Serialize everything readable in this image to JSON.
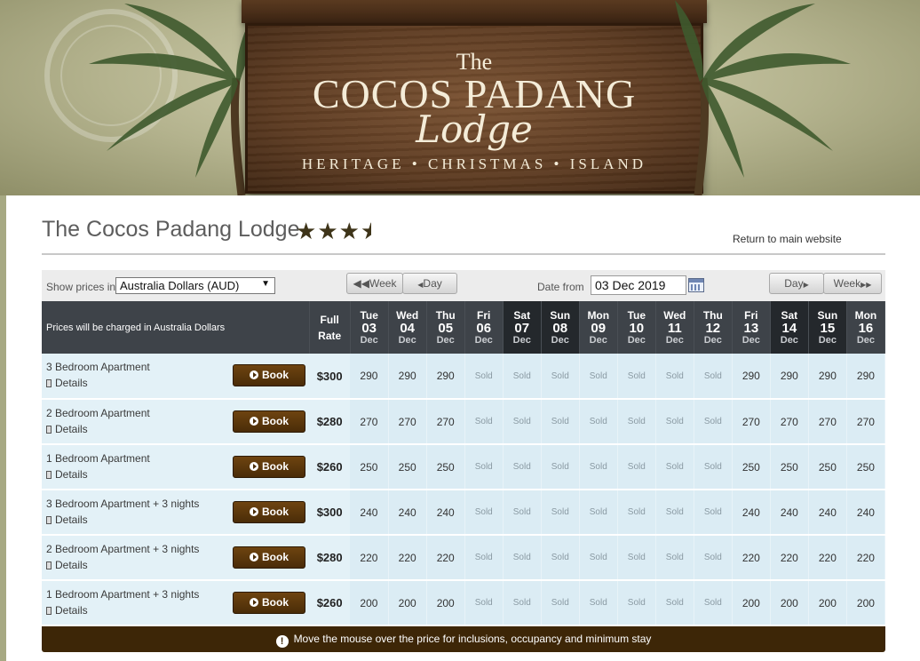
{
  "banner": {
    "logo_the": "The",
    "logo_name": "COCOS PADANG",
    "logo_lodge": "Lodge",
    "logo_tagline": "HERITAGE • CHRISTMAS • ISLAND"
  },
  "page": {
    "title": "The Cocos Padang Lodge",
    "star_rating": 3.5,
    "return_link": "Return to main website"
  },
  "controls": {
    "show_prices_label": "Show prices in",
    "currency_value": "Australia Dollars (AUD)",
    "prev_week_label": "Week",
    "prev_day_label": "Day",
    "date_from_label": "Date from",
    "date_from_value": "03 Dec 2019",
    "next_day_label": "Day",
    "next_week_label": "Week"
  },
  "table": {
    "charged_note": "Prices will be charged in Australia Dollars",
    "full_rate_label_1": "Full",
    "full_rate_label_2": "Rate",
    "book_label": "Book",
    "details_label": "Details",
    "dates": [
      {
        "day": "Tue",
        "date": "03",
        "month": "Dec"
      },
      {
        "day": "Wed",
        "date": "04",
        "month": "Dec"
      },
      {
        "day": "Thu",
        "date": "05",
        "month": "Dec"
      },
      {
        "day": "Fri",
        "date": "06",
        "month": "Dec"
      },
      {
        "day": "Sat",
        "date": "07",
        "month": "Dec"
      },
      {
        "day": "Sun",
        "date": "08",
        "month": "Dec"
      },
      {
        "day": "Mon",
        "date": "09",
        "month": "Dec"
      },
      {
        "day": "Tue",
        "date": "10",
        "month": "Dec"
      },
      {
        "day": "Wed",
        "date": "11",
        "month": "Dec"
      },
      {
        "day": "Thu",
        "date": "12",
        "month": "Dec"
      },
      {
        "day": "Fri",
        "date": "13",
        "month": "Dec"
      },
      {
        "day": "Sat",
        "date": "14",
        "month": "Dec"
      },
      {
        "day": "Sun",
        "date": "15",
        "month": "Dec"
      },
      {
        "day": "Mon",
        "date": "16",
        "month": "Dec"
      }
    ],
    "rooms": [
      {
        "name": "3 Bedroom Apartment",
        "full_rate": "$300",
        "prices": [
          "290",
          "290",
          "290",
          "Sold",
          "Sold",
          "Sold",
          "Sold",
          "Sold",
          "Sold",
          "Sold",
          "290",
          "290",
          "290",
          "290"
        ]
      },
      {
        "name": "2 Bedroom Apartment",
        "full_rate": "$280",
        "prices": [
          "270",
          "270",
          "270",
          "Sold",
          "Sold",
          "Sold",
          "Sold",
          "Sold",
          "Sold",
          "Sold",
          "270",
          "270",
          "270",
          "270"
        ]
      },
      {
        "name": "1 Bedroom Apartment",
        "full_rate": "$260",
        "prices": [
          "250",
          "250",
          "250",
          "Sold",
          "Sold",
          "Sold",
          "Sold",
          "Sold",
          "Sold",
          "Sold",
          "250",
          "250",
          "250",
          "250"
        ]
      },
      {
        "name": "3 Bedroom Apartment + 3 nights",
        "full_rate": "$300",
        "prices": [
          "240",
          "240",
          "240",
          "Sold",
          "Sold",
          "Sold",
          "Sold",
          "Sold",
          "Sold",
          "Sold",
          "240",
          "240",
          "240",
          "240"
        ]
      },
      {
        "name": "2 Bedroom Apartment + 3 nights",
        "full_rate": "$280",
        "prices": [
          "220",
          "220",
          "220",
          "Sold",
          "Sold",
          "Sold",
          "Sold",
          "Sold",
          "Sold",
          "Sold",
          "220",
          "220",
          "220",
          "220"
        ]
      },
      {
        "name": "1 Bedroom Apartment + 3 nights",
        "full_rate": "$260",
        "prices": [
          "200",
          "200",
          "200",
          "Sold",
          "Sold",
          "Sold",
          "Sold",
          "Sold",
          "Sold",
          "Sold",
          "200",
          "200",
          "200",
          "200"
        ]
      }
    ]
  },
  "footer": {
    "hint": "Move the mouse over the price for inclusions, occupancy and minimum stay"
  },
  "colors": {
    "header_bg": "#3e4349",
    "weekend_header_bg": "#24282c",
    "cell_bg": "#dbecf4",
    "book_button": "#5a3610",
    "footer_bg": "#3d2607"
  }
}
